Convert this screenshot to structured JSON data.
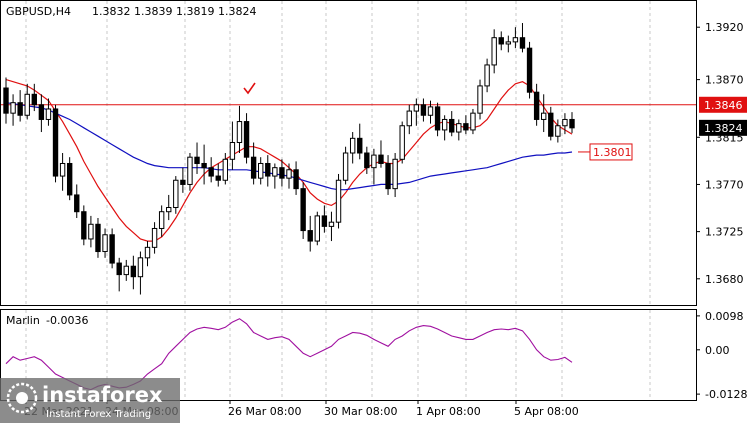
{
  "header": {
    "symbol": "GBPUSD,H4",
    "ohlc": "1.3832 1.3839 1.3819 1.3824"
  },
  "indicator": {
    "name": "Marlin",
    "value": "-0.0036"
  },
  "watermark": {
    "brand": "instaforex",
    "tagline": "Instant Forex Trading"
  },
  "colors": {
    "bull": "#ffffff",
    "bear": "#000000",
    "ma_red": "#e01010",
    "ma_blue": "#1010c0",
    "osc": "#a010a0",
    "level_line": "#e01010"
  },
  "chart_data": [
    {
      "type": "candlestick",
      "title": "GBPUSD,H4",
      "ylim": [
        1.3655,
        1.3945
      ],
      "y_ticks": [
        "1.3920",
        "1.3870",
        "1.3815",
        "1.3770",
        "1.3725",
        "1.3680"
      ],
      "x_ticks": [
        "22 Mar 2021",
        "24 Mar 08:00",
        "26 Mar 08:00",
        "30 Mar 08:00",
        "1 Apr 08:00",
        "5 Apr 08:00"
      ],
      "price_labels": {
        "level": "1.3846",
        "current": "1.3824",
        "ma_blue_value": "1.3801"
      },
      "horizontal_level": 1.3846,
      "candles": [
        [
          1.3862,
          1.3872,
          1.3828,
          1.3838
        ],
        [
          1.3838,
          1.3856,
          1.3826,
          1.3848
        ],
        [
          1.3848,
          1.386,
          1.383,
          1.3836
        ],
        [
          1.3836,
          1.3866,
          1.3832,
          1.3856
        ],
        [
          1.3856,
          1.3866,
          1.384,
          1.3846
        ],
        [
          1.3846,
          1.3856,
          1.382,
          1.3832
        ],
        [
          1.3832,
          1.3852,
          1.3826,
          1.3842
        ],
        [
          1.3842,
          1.3846,
          1.3772,
          1.3778
        ],
        [
          1.3778,
          1.38,
          1.3764,
          1.379
        ],
        [
          1.379,
          1.3796,
          1.3755,
          1.376
        ],
        [
          1.376,
          1.377,
          1.3738,
          1.3744
        ],
        [
          1.3744,
          1.375,
          1.3712,
          1.3718
        ],
        [
          1.3718,
          1.374,
          1.371,
          1.3732
        ],
        [
          1.3732,
          1.3738,
          1.37,
          1.3706
        ],
        [
          1.3706,
          1.3728,
          1.37,
          1.3722
        ],
        [
          1.3722,
          1.3728,
          1.369,
          1.3695
        ],
        [
          1.3695,
          1.37,
          1.3668,
          1.3684
        ],
        [
          1.3684,
          1.3698,
          1.3678,
          1.3692
        ],
        [
          1.3692,
          1.3702,
          1.367,
          1.3682
        ],
        [
          1.3682,
          1.3706,
          1.3665,
          1.37
        ],
        [
          1.37,
          1.3716,
          1.3692,
          1.371
        ],
        [
          1.371,
          1.3734,
          1.3704,
          1.3728
        ],
        [
          1.3728,
          1.375,
          1.372,
          1.3744
        ],
        [
          1.3744,
          1.376,
          1.3736,
          1.3748
        ],
        [
          1.3748,
          1.3778,
          1.3742,
          1.3774
        ],
        [
          1.3774,
          1.3786,
          1.3762,
          1.377
        ],
        [
          1.377,
          1.38,
          1.3764,
          1.3796
        ],
        [
          1.3796,
          1.381,
          1.378,
          1.379
        ],
        [
          1.379,
          1.3808,
          1.377,
          1.3786
        ],
        [
          1.3786,
          1.3796,
          1.3772,
          1.3778
        ],
        [
          1.3778,
          1.379,
          1.3768,
          1.3774
        ],
        [
          1.3774,
          1.38,
          1.377,
          1.3794
        ],
        [
          1.3794,
          1.383,
          1.3784,
          1.381
        ],
        [
          1.381,
          1.3845,
          1.38,
          1.383
        ],
        [
          1.383,
          1.3838,
          1.379,
          1.3796
        ],
        [
          1.3796,
          1.381,
          1.377,
          1.3776
        ],
        [
          1.3776,
          1.3796,
          1.377,
          1.379
        ],
        [
          1.379,
          1.3798,
          1.3768,
          1.3778
        ],
        [
          1.3778,
          1.379,
          1.3766,
          1.3786
        ],
        [
          1.3786,
          1.3794,
          1.3768,
          1.3776
        ],
        [
          1.3776,
          1.379,
          1.3766,
          1.3784
        ],
        [
          1.3784,
          1.3792,
          1.376,
          1.3766
        ],
        [
          1.3766,
          1.3772,
          1.3718,
          1.3726
        ],
        [
          1.3726,
          1.374,
          1.3706,
          1.3716
        ],
        [
          1.3716,
          1.3744,
          1.3712,
          1.374
        ],
        [
          1.374,
          1.375,
          1.3724,
          1.373
        ],
        [
          1.373,
          1.3744,
          1.3716,
          1.3734
        ],
        [
          1.3734,
          1.378,
          1.3728,
          1.3774
        ],
        [
          1.3774,
          1.3806,
          1.377,
          1.38
        ],
        [
          1.38,
          1.382,
          1.379,
          1.3814
        ],
        [
          1.3814,
          1.3828,
          1.3794,
          1.38
        ],
        [
          1.38,
          1.3806,
          1.378,
          1.3786
        ],
        [
          1.3786,
          1.3804,
          1.377,
          1.3798
        ],
        [
          1.3798,
          1.3812,
          1.3786,
          1.379
        ],
        [
          1.379,
          1.3798,
          1.376,
          1.3766
        ],
        [
          1.3766,
          1.38,
          1.3758,
          1.3794
        ],
        [
          1.3794,
          1.383,
          1.379,
          1.3826
        ],
        [
          1.3826,
          1.3846,
          1.3818,
          1.384
        ],
        [
          1.384,
          1.3852,
          1.3826,
          1.3846
        ],
        [
          1.3846,
          1.3852,
          1.383,
          1.3836
        ],
        [
          1.3836,
          1.385,
          1.3828,
          1.3844
        ],
        [
          1.3844,
          1.3848,
          1.3816,
          1.3822
        ],
        [
          1.3822,
          1.3836,
          1.3812,
          1.3832
        ],
        [
          1.3832,
          1.384,
          1.3816,
          1.382
        ],
        [
          1.382,
          1.3832,
          1.3812,
          1.3828
        ],
        [
          1.3828,
          1.3836,
          1.3818,
          1.3822
        ],
        [
          1.3822,
          1.3842,
          1.3818,
          1.3838
        ],
        [
          1.3838,
          1.387,
          1.3832,
          1.3864
        ],
        [
          1.3864,
          1.389,
          1.3858,
          1.3884
        ],
        [
          1.3884,
          1.3918,
          1.3876,
          1.391
        ],
        [
          1.391,
          1.3916,
          1.3898,
          1.3904
        ],
        [
          1.3904,
          1.3912,
          1.3896,
          1.3906
        ],
        [
          1.3906,
          1.392,
          1.39,
          1.391
        ],
        [
          1.391,
          1.3924,
          1.3896,
          1.39
        ],
        [
          1.39,
          1.3906,
          1.3852,
          1.3858
        ],
        [
          1.3858,
          1.3866,
          1.3826,
          1.3832
        ],
        [
          1.3832,
          1.3856,
          1.382,
          1.3838
        ],
        [
          1.3838,
          1.3844,
          1.3812,
          1.3816
        ],
        [
          1.3816,
          1.3832,
          1.381,
          1.3826
        ],
        [
          1.3826,
          1.3838,
          1.3818,
          1.3832
        ],
        [
          1.3832,
          1.3839,
          1.3819,
          1.3824
        ]
      ],
      "series": [
        {
          "color": "#e01010",
          "values": [
            1.387,
            1.3868,
            1.3866,
            1.3864,
            1.386,
            1.3855,
            1.385,
            1.384,
            1.383,
            1.3818,
            1.3806,
            1.3792,
            1.378,
            1.3768,
            1.3758,
            1.3748,
            1.3738,
            1.373,
            1.3724,
            1.3718,
            1.3716,
            1.3716,
            1.372,
            1.3728,
            1.3738,
            1.375,
            1.3762,
            1.3772,
            1.378,
            1.3786,
            1.379,
            1.3794,
            1.3798,
            1.3802,
            1.3806,
            1.3806,
            1.3804,
            1.38,
            1.3796,
            1.3792,
            1.3786,
            1.378,
            1.3772,
            1.3762,
            1.3756,
            1.3752,
            1.375,
            1.3754,
            1.3762,
            1.3772,
            1.378,
            1.3786,
            1.379,
            1.3792,
            1.379,
            1.379,
            1.3794,
            1.3802,
            1.381,
            1.3818,
            1.3824,
            1.3828,
            1.383,
            1.3828,
            1.3826,
            1.3824,
            1.3824,
            1.3826,
            1.3832,
            1.3842,
            1.3852,
            1.386,
            1.3866,
            1.3868,
            1.3864,
            1.3854,
            1.3844,
            1.3834,
            1.3826,
            1.3822,
            1.3818
          ]
        },
        {
          "color": "#1010c0",
          "values": [
            1.3848,
            1.3847,
            1.3846,
            1.3845,
            1.3844,
            1.3843,
            1.3841,
            1.3838,
            1.3835,
            1.3832,
            1.3828,
            1.3824,
            1.382,
            1.3816,
            1.3812,
            1.3808,
            1.3804,
            1.38,
            1.3796,
            1.3793,
            1.379,
            1.3788,
            1.3787,
            1.3786,
            1.3786,
            1.3786,
            1.3786,
            1.3786,
            1.3786,
            1.3785,
            1.3784,
            1.3784,
            1.3784,
            1.3784,
            1.3784,
            1.3783,
            1.3782,
            1.3781,
            1.378,
            1.3779,
            1.3778,
            1.3776,
            1.3774,
            1.3772,
            1.377,
            1.3768,
            1.3766,
            1.3765,
            1.3765,
            1.3766,
            1.3767,
            1.3768,
            1.3769,
            1.377,
            1.377,
            1.377,
            1.3771,
            1.3772,
            1.3774,
            1.3776,
            1.3778,
            1.3779,
            1.378,
            1.3781,
            1.3782,
            1.3783,
            1.3784,
            1.3785,
            1.3786,
            1.3788,
            1.379,
            1.3792,
            1.3794,
            1.3796,
            1.3797,
            1.3798,
            1.3798,
            1.3799,
            1.38,
            1.38,
            1.3801
          ]
        }
      ]
    },
    {
      "type": "line",
      "title": "Marlin -0.0036",
      "ylim": [
        -0.0145,
        0.0115
      ],
      "y_ticks": [
        "0.0098",
        "0.00",
        "-0.0128"
      ],
      "series": [
        {
          "color": "#a010a0",
          "values": [
            -0.004,
            -0.002,
            -0.003,
            -0.0025,
            -0.002,
            -0.003,
            -0.005,
            -0.007,
            -0.008,
            -0.009,
            -0.01,
            -0.011,
            -0.0115,
            -0.0105,
            -0.01,
            -0.0105,
            -0.011,
            -0.0108,
            -0.01,
            -0.009,
            -0.007,
            -0.0055,
            -0.004,
            -0.001,
            0.001,
            0.003,
            0.005,
            0.006,
            0.0065,
            0.0062,
            0.0058,
            0.0065,
            0.008,
            0.009,
            0.0075,
            0.005,
            0.004,
            0.003,
            0.0035,
            0.0038,
            0.003,
            0.001,
            -0.001,
            -0.002,
            -0.001,
            0.0,
            0.001,
            0.003,
            0.004,
            0.005,
            0.0048,
            0.0042,
            0.003,
            0.002,
            0.001,
            0.003,
            0.004,
            0.0055,
            0.0065,
            0.007,
            0.0068,
            0.006,
            0.005,
            0.004,
            0.0035,
            0.003,
            0.003,
            0.004,
            0.005,
            0.0058,
            0.006,
            0.0058,
            0.0062,
            0.0055,
            0.003,
            0.0,
            -0.002,
            -0.003,
            -0.0028,
            -0.0022,
            -0.0036
          ]
        }
      ]
    }
  ]
}
